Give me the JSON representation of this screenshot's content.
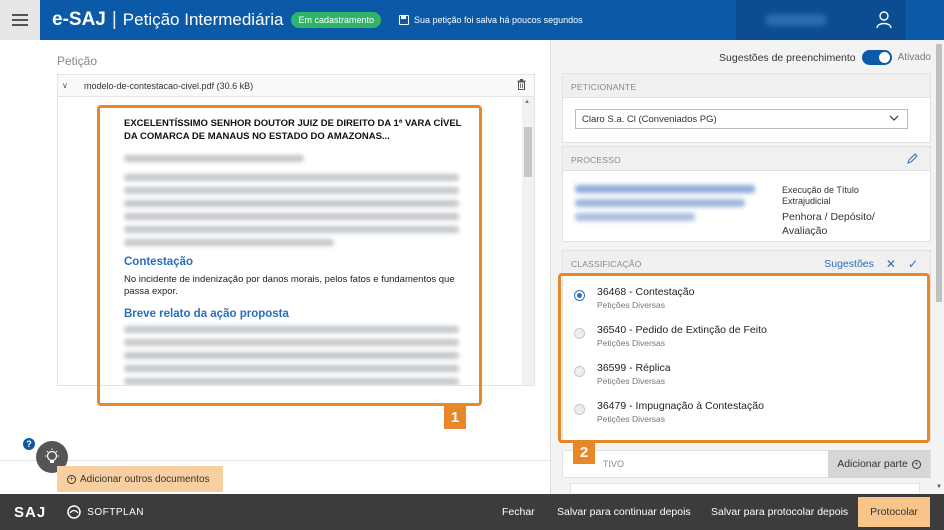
{
  "header": {
    "brand": "e-SAJ",
    "separator": "|",
    "app_title": "Petição Intermediária",
    "status_badge": "Em cadastramento",
    "save_note": "Sua petição foi salva há poucos segundos"
  },
  "left": {
    "section_label": "Petição",
    "file_name": "modelo-de-contestacao-civel.pdf (30.6 kB)",
    "document": {
      "heading": "EXCELENTÍSSIMO SENHOR DOUTOR JUIZ DE DIREITO DA 1ª VARA CÍVEL DA COMARCA DE MANAUS NO ESTADO DO AMAZONAS...",
      "section1_title": "Contestação",
      "section1_text": "No incidente de indenização por danos morais, pelos fatos e fundamentos que passa expor.",
      "section2_title": "Breve relato da ação proposta"
    },
    "badge_1": "1",
    "help_label": "?",
    "add_docs_label": "Adicionar outros documentos"
  },
  "right": {
    "suggestions_label": "Sugestões de preenchimento",
    "toggle_state": "Ativado",
    "peticionante": {
      "title": "PETICIONANTE",
      "selected": "Claro S.a. Cl (Conveniados PG)"
    },
    "processo": {
      "title": "PROCESSO",
      "line1": "Execução de Título",
      "line2": "Extrajudicial",
      "line3": "Penhora / Depósito/",
      "line4": "Avaliação"
    },
    "classificacao": {
      "title": "CLASSIFICAÇÃO",
      "suggestions_link": "Sugestões",
      "items": [
        {
          "title": "36468 - Contestação",
          "sub": "Petições Diversas",
          "selected": true
        },
        {
          "title": "36540 - Pedido de Extinção de Feito",
          "sub": "Petições Diversas",
          "selected": false
        },
        {
          "title": "36599 - Réplica",
          "sub": "Petições Diversas",
          "selected": false
        },
        {
          "title": "36479 - Impugnação à Contestação",
          "sub": "Petições Diversas",
          "selected": false
        }
      ]
    },
    "badge_2": "2",
    "rep_label": "TIVO",
    "add_part_label": "Adicionar parte"
  },
  "footer": {
    "logo": "SAJ",
    "company": "SOFTPLAN",
    "fechar": "Fechar",
    "salvar_continuar": "Salvar para continuar depois",
    "salvar_protocolar": "Salvar para protocolar depois",
    "protocolar": "Protocolar"
  },
  "colors": {
    "header_blue": "#0a5aa8",
    "highlight_orange": "#e8862a",
    "status_green": "#2fb46a",
    "footer_dark": "#3c3c3c"
  }
}
